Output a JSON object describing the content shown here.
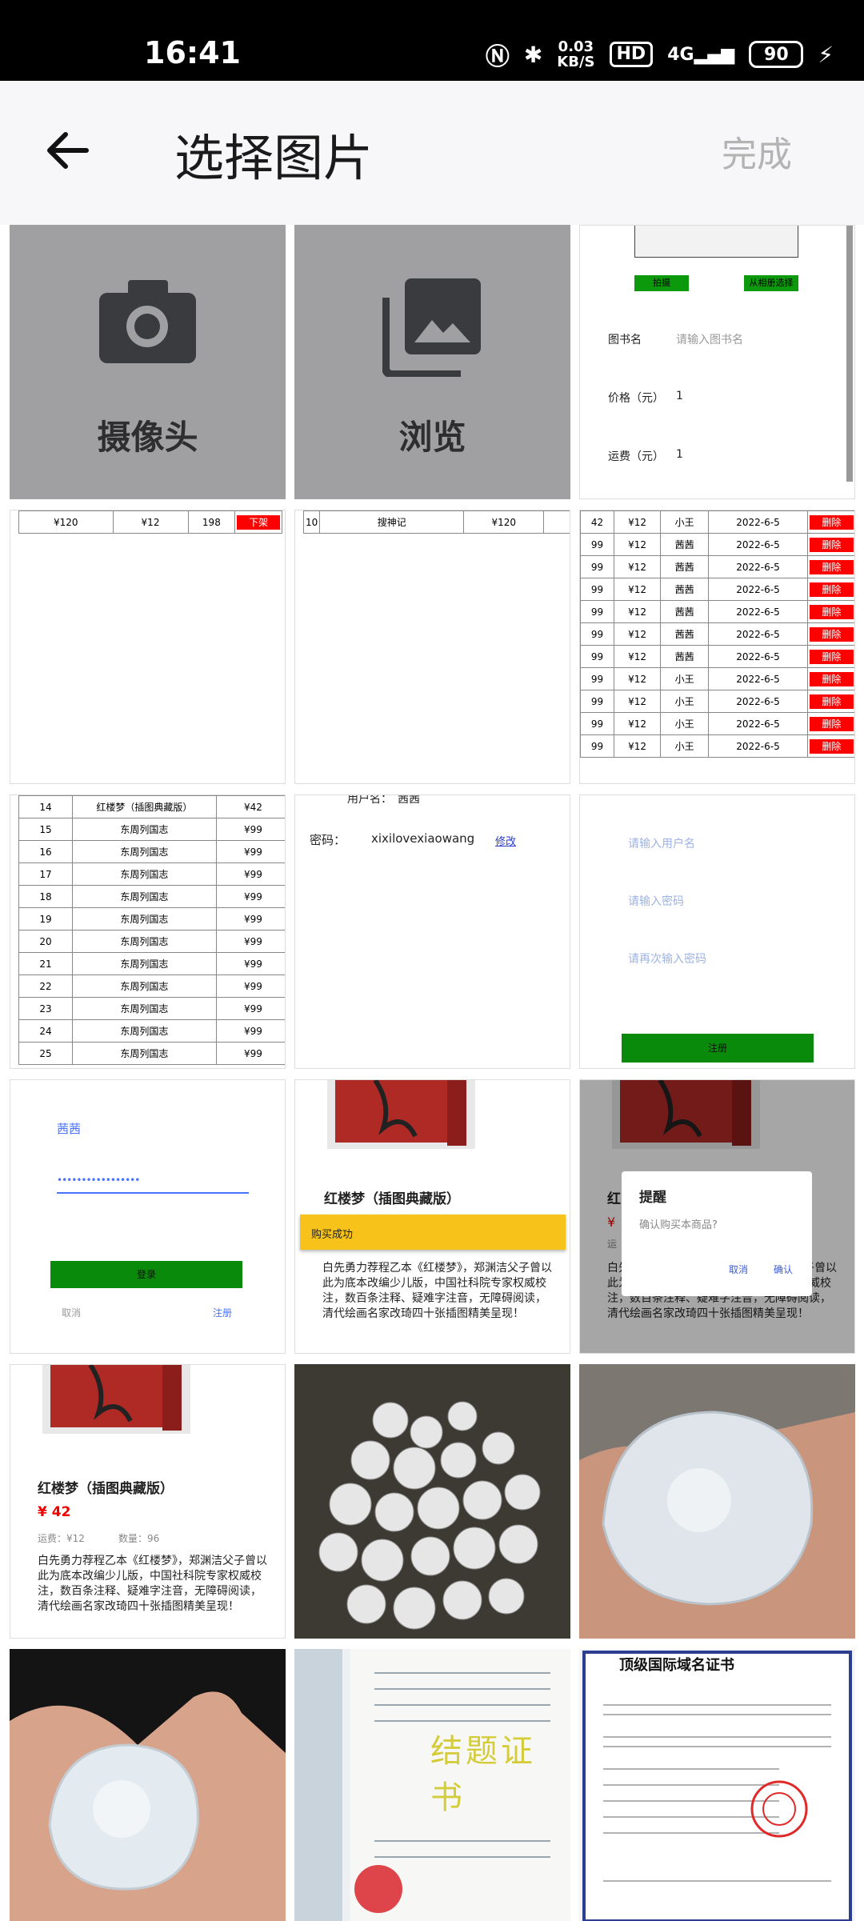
{
  "status_bar": {
    "time": "16:41",
    "speed_value": "0.03",
    "speed_unit": "KB/S",
    "hd": "HD",
    "network": "4G",
    "battery": "90"
  },
  "header": {
    "title": "选择图片",
    "done_label": "完成"
  },
  "tiles": {
    "camera_label": "摄像头",
    "browse_label": "浏览",
    "book_form": {
      "take_photo": "拍摄",
      "from_album": "从相册选择",
      "book_name_label": "图书名",
      "book_name_placeholder": "请输入图书名",
      "price_label": "价格（元）",
      "price_value": "1",
      "shipping_label": "运费（元）",
      "shipping_value": "1"
    },
    "row_120": {
      "price": "¥120",
      "fee": "¥12",
      "qty": "198",
      "action": "下架"
    },
    "row_10": {
      "id": "10",
      "name": "搜神记",
      "price": "¥120"
    },
    "order_rows": [
      {
        "a": "42",
        "b": "¥12",
        "c": "小王",
        "d": "2022-6-5",
        "e": "删除"
      },
      {
        "a": "99",
        "b": "¥12",
        "c": "茜茜",
        "d": "2022-6-5",
        "e": "删除"
      },
      {
        "a": "99",
        "b": "¥12",
        "c": "茜茜",
        "d": "2022-6-5",
        "e": "删除"
      },
      {
        "a": "99",
        "b": "¥12",
        "c": "茜茜",
        "d": "2022-6-5",
        "e": "删除"
      },
      {
        "a": "99",
        "b": "¥12",
        "c": "茜茜",
        "d": "2022-6-5",
        "e": "删除"
      },
      {
        "a": "99",
        "b": "¥12",
        "c": "茜茜",
        "d": "2022-6-5",
        "e": "删除"
      },
      {
        "a": "99",
        "b": "¥12",
        "c": "茜茜",
        "d": "2022-6-5",
        "e": "删除"
      },
      {
        "a": "99",
        "b": "¥12",
        "c": "小王",
        "d": "2022-6-5",
        "e": "删除"
      },
      {
        "a": "99",
        "b": "¥12",
        "c": "小王",
        "d": "2022-6-5",
        "e": "删除"
      },
      {
        "a": "99",
        "b": "¥12",
        "c": "小王",
        "d": "2022-6-5",
        "e": "删除"
      },
      {
        "a": "99",
        "b": "¥12",
        "c": "小王",
        "d": "2022-6-5",
        "e": "删除"
      }
    ],
    "book_rows": [
      {
        "id": "14",
        "name": "红楼梦（插图典藏版）",
        "price": "¥42"
      },
      {
        "id": "15",
        "name": "东周列国志",
        "price": "¥99"
      },
      {
        "id": "16",
        "name": "东周列国志",
        "price": "¥99"
      },
      {
        "id": "17",
        "name": "东周列国志",
        "price": "¥99"
      },
      {
        "id": "18",
        "name": "东周列国志",
        "price": "¥99"
      },
      {
        "id": "19",
        "name": "东周列国志",
        "price": "¥99"
      },
      {
        "id": "20",
        "name": "东周列国志",
        "price": "¥99"
      },
      {
        "id": "21",
        "name": "东周列国志",
        "price": "¥99"
      },
      {
        "id": "22",
        "name": "东周列国志",
        "price": "¥99"
      },
      {
        "id": "23",
        "name": "东周列国志",
        "price": "¥99"
      },
      {
        "id": "24",
        "name": "东周列国志",
        "price": "¥99"
      },
      {
        "id": "25",
        "name": "东周列国志",
        "price": "¥99"
      }
    ],
    "password": {
      "partial_label": "用户名：",
      "partial_value": "茜茜",
      "label": "密码：",
      "value": "xixilovexiaowang",
      "edit": "修改"
    },
    "register": {
      "username_placeholder": "请输入用户名",
      "password_placeholder": "请输入密码",
      "confirm_placeholder": "请再次输入密码",
      "button": "注册"
    },
    "login": {
      "username": "茜茜",
      "password_mask": "•••••••••••••••••",
      "login_button": "登录",
      "cancel": "取消",
      "register": "注册"
    },
    "book_detail": {
      "title": "红楼梦（插图典藏版）",
      "toast": "购买成功",
      "desc": "白先勇力荐程乙本《红楼梦》，郑渊洁父子曾以此为底本改编少儿版，中国社科院专家权威校注，数百条注释、疑难字注音，无障碍阅读，清代绘画名家改琦四十张插图精美呈现！"
    },
    "dialog": {
      "title": "提醒",
      "message": "确认购买本商品?",
      "cancel": "取消",
      "confirm": "确认",
      "bg_title": "红",
      "bg_price": "¥",
      "bg_shipping": "运"
    },
    "book_detail2": {
      "title": "红楼梦（插图典藏版）",
      "price": "¥ 42",
      "shipping": "运费：¥12",
      "qty": "数量：96",
      "desc": "白先勇力荐程乙本《红楼梦》，郑渊洁父子曾以此为底本改编少儿版，中国社科院专家权威校注，数百条注释、疑难字注音，无障碍阅读，清代绘画名家改琦四十张插图精美呈现！"
    },
    "cert1_title": "结题证书",
    "cert2_title": "顶级国际域名证书"
  }
}
